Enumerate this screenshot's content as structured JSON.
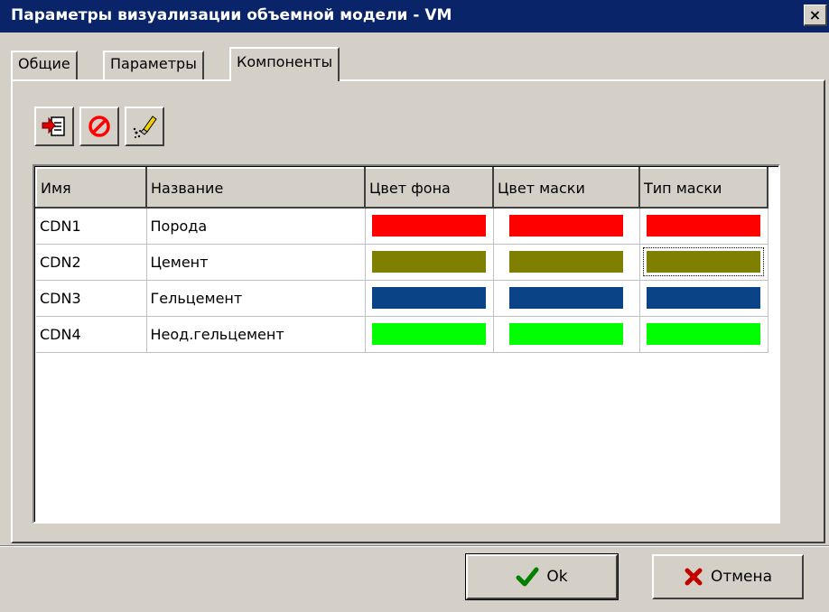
{
  "window": {
    "title": "Параметры визуализации объемной модели - VM",
    "close_label": "×"
  },
  "tabs": [
    {
      "label": "Общие",
      "active": false
    },
    {
      "label": "Параметры",
      "active": false
    },
    {
      "label": "Компоненты",
      "active": true
    }
  ],
  "toolbar": {
    "buttons": [
      {
        "icon": "import-icon"
      },
      {
        "icon": "cancel-icon"
      },
      {
        "icon": "clear-icon"
      }
    ]
  },
  "grid": {
    "columns": [
      "Имя",
      "Название",
      "Цвет фона",
      "Цвет маски",
      "Тип маски"
    ],
    "rows": [
      {
        "name": "CDN1",
        "title": "Порода",
        "bg_color": "#ff0000",
        "mask_color": "#ff0000",
        "mask_type_color": "#ff0000"
      },
      {
        "name": "CDN2",
        "title": "Цемент",
        "bg_color": "#808000",
        "mask_color": "#808000",
        "mask_type_color": "#808000"
      },
      {
        "name": "CDN3",
        "title": "Гельцемент",
        "bg_color": "#0a4486",
        "mask_color": "#0a4486",
        "mask_type_color": "#0a4486"
      },
      {
        "name": "CDN4",
        "title": "Неод.гельцемент",
        "bg_color": "#00ff00",
        "mask_color": "#00ff00",
        "mask_type_color": "#00ff00"
      }
    ],
    "focused_cell": {
      "row": 1,
      "column": 4
    }
  },
  "buttons": {
    "ok_label": "Ok",
    "cancel_label": "Отмена"
  }
}
